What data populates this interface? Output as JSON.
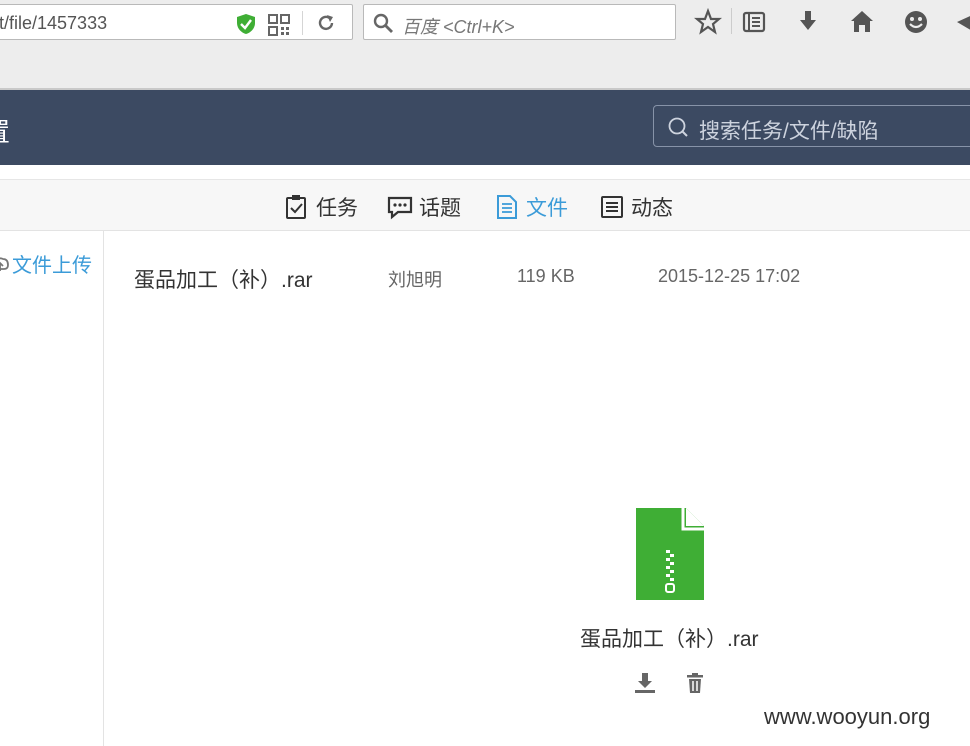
{
  "browser": {
    "url": "t/file/1457333",
    "search_placeholder": "百度 <Ctrl+K>",
    "toolbar_icons": [
      "star-icon",
      "reading-list-icon",
      "download-icon",
      "home-icon",
      "smiley-icon",
      "send-icon"
    ]
  },
  "header": {
    "title": "置",
    "search_placeholder": "搜索任务/文件/缺陷",
    "background": "#3c4a62"
  },
  "tabs": [
    {
      "label": "任务",
      "icon": "task-icon",
      "active": false
    },
    {
      "label": "话题",
      "icon": "topic-icon",
      "active": false
    },
    {
      "label": "文件",
      "icon": "file-icon",
      "active": true
    },
    {
      "label": "动态",
      "icon": "activity-icon",
      "active": false
    }
  ],
  "sidebar": {
    "upload_label": "文件上传"
  },
  "file_list": [
    {
      "name": "蛋品加工（补）.rar",
      "uploader": "刘旭明",
      "size": "119 KB",
      "date": "2015-12-25 17:02"
    }
  ],
  "preview": {
    "file_name": "蛋品加工（补）.rar",
    "icon": "zip-file-icon",
    "icon_color": "#3fae35",
    "actions": [
      "download-icon",
      "delete-icon"
    ]
  },
  "watermark": "www.wooyun.org",
  "colors": {
    "accent": "#3b9bd8",
    "header_bg": "#3c4a62"
  }
}
